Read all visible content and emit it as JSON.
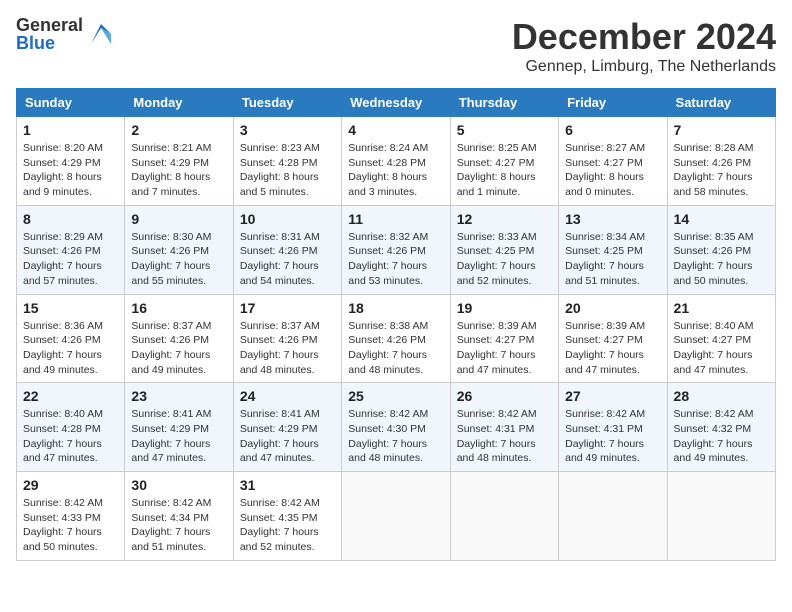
{
  "logo": {
    "general": "General",
    "blue": "Blue"
  },
  "header": {
    "month": "December 2024",
    "location": "Gennep, Limburg, The Netherlands"
  },
  "weekdays": [
    "Sunday",
    "Monday",
    "Tuesday",
    "Wednesday",
    "Thursday",
    "Friday",
    "Saturday"
  ],
  "weeks": [
    [
      {
        "day": "1",
        "sunrise": "8:20 AM",
        "sunset": "4:29 PM",
        "daylight": "8 hours and 9 minutes."
      },
      {
        "day": "2",
        "sunrise": "8:21 AM",
        "sunset": "4:29 PM",
        "daylight": "8 hours and 7 minutes."
      },
      {
        "day": "3",
        "sunrise": "8:23 AM",
        "sunset": "4:28 PM",
        "daylight": "8 hours and 5 minutes."
      },
      {
        "day": "4",
        "sunrise": "8:24 AM",
        "sunset": "4:28 PM",
        "daylight": "8 hours and 3 minutes."
      },
      {
        "day": "5",
        "sunrise": "8:25 AM",
        "sunset": "4:27 PM",
        "daylight": "8 hours and 1 minute."
      },
      {
        "day": "6",
        "sunrise": "8:27 AM",
        "sunset": "4:27 PM",
        "daylight": "8 hours and 0 minutes."
      },
      {
        "day": "7",
        "sunrise": "8:28 AM",
        "sunset": "4:26 PM",
        "daylight": "7 hours and 58 minutes."
      }
    ],
    [
      {
        "day": "8",
        "sunrise": "8:29 AM",
        "sunset": "4:26 PM",
        "daylight": "7 hours and 57 minutes."
      },
      {
        "day": "9",
        "sunrise": "8:30 AM",
        "sunset": "4:26 PM",
        "daylight": "7 hours and 55 minutes."
      },
      {
        "day": "10",
        "sunrise": "8:31 AM",
        "sunset": "4:26 PM",
        "daylight": "7 hours and 54 minutes."
      },
      {
        "day": "11",
        "sunrise": "8:32 AM",
        "sunset": "4:26 PM",
        "daylight": "7 hours and 53 minutes."
      },
      {
        "day": "12",
        "sunrise": "8:33 AM",
        "sunset": "4:25 PM",
        "daylight": "7 hours and 52 minutes."
      },
      {
        "day": "13",
        "sunrise": "8:34 AM",
        "sunset": "4:25 PM",
        "daylight": "7 hours and 51 minutes."
      },
      {
        "day": "14",
        "sunrise": "8:35 AM",
        "sunset": "4:26 PM",
        "daylight": "7 hours and 50 minutes."
      }
    ],
    [
      {
        "day": "15",
        "sunrise": "8:36 AM",
        "sunset": "4:26 PM",
        "daylight": "7 hours and 49 minutes."
      },
      {
        "day": "16",
        "sunrise": "8:37 AM",
        "sunset": "4:26 PM",
        "daylight": "7 hours and 49 minutes."
      },
      {
        "day": "17",
        "sunrise": "8:37 AM",
        "sunset": "4:26 PM",
        "daylight": "7 hours and 48 minutes."
      },
      {
        "day": "18",
        "sunrise": "8:38 AM",
        "sunset": "4:26 PM",
        "daylight": "7 hours and 48 minutes."
      },
      {
        "day": "19",
        "sunrise": "8:39 AM",
        "sunset": "4:27 PM",
        "daylight": "7 hours and 47 minutes."
      },
      {
        "day": "20",
        "sunrise": "8:39 AM",
        "sunset": "4:27 PM",
        "daylight": "7 hours and 47 minutes."
      },
      {
        "day": "21",
        "sunrise": "8:40 AM",
        "sunset": "4:27 PM",
        "daylight": "7 hours and 47 minutes."
      }
    ],
    [
      {
        "day": "22",
        "sunrise": "8:40 AM",
        "sunset": "4:28 PM",
        "daylight": "7 hours and 47 minutes."
      },
      {
        "day": "23",
        "sunrise": "8:41 AM",
        "sunset": "4:29 PM",
        "daylight": "7 hours and 47 minutes."
      },
      {
        "day": "24",
        "sunrise": "8:41 AM",
        "sunset": "4:29 PM",
        "daylight": "7 hours and 47 minutes."
      },
      {
        "day": "25",
        "sunrise": "8:42 AM",
        "sunset": "4:30 PM",
        "daylight": "7 hours and 48 minutes."
      },
      {
        "day": "26",
        "sunrise": "8:42 AM",
        "sunset": "4:31 PM",
        "daylight": "7 hours and 48 minutes."
      },
      {
        "day": "27",
        "sunrise": "8:42 AM",
        "sunset": "4:31 PM",
        "daylight": "7 hours and 49 minutes."
      },
      {
        "day": "28",
        "sunrise": "8:42 AM",
        "sunset": "4:32 PM",
        "daylight": "7 hours and 49 minutes."
      }
    ],
    [
      {
        "day": "29",
        "sunrise": "8:42 AM",
        "sunset": "4:33 PM",
        "daylight": "7 hours and 50 minutes."
      },
      {
        "day": "30",
        "sunrise": "8:42 AM",
        "sunset": "4:34 PM",
        "daylight": "7 hours and 51 minutes."
      },
      {
        "day": "31",
        "sunrise": "8:42 AM",
        "sunset": "4:35 PM",
        "daylight": "7 hours and 52 minutes."
      },
      null,
      null,
      null,
      null
    ]
  ],
  "labels": {
    "sunrise": "Sunrise:",
    "sunset": "Sunset:",
    "daylight": "Daylight:"
  }
}
